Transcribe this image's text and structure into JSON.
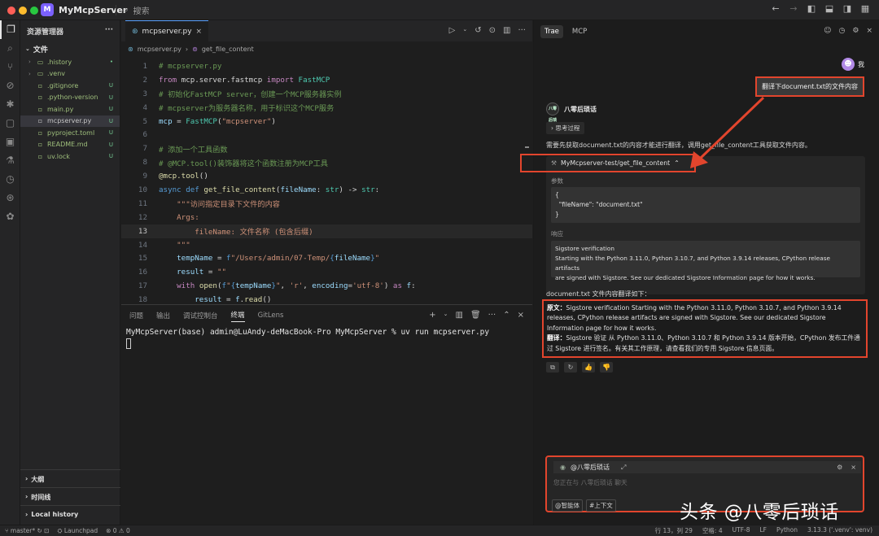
{
  "window": {
    "project_badge": "M",
    "project_name": "MyMcpServer",
    "search_placeholder": "搜索"
  },
  "explorer": {
    "title": "资源管理器",
    "section": "文件",
    "items": [
      {
        "name": ".history",
        "kind": "folder",
        "badge": "•"
      },
      {
        "name": ".venv",
        "kind": "folder",
        "badge": ""
      },
      {
        "name": ".gitignore",
        "kind": "file",
        "badge": "U"
      },
      {
        "name": ".python-version",
        "kind": "file",
        "badge": "U"
      },
      {
        "name": "main.py",
        "kind": "file",
        "badge": "U"
      },
      {
        "name": "mcpserver.py",
        "kind": "file",
        "badge": "U"
      },
      {
        "name": "pyproject.toml",
        "kind": "file",
        "badge": "U"
      },
      {
        "name": "README.md",
        "kind": "file",
        "badge": "U"
      },
      {
        "name": "uv.lock",
        "kind": "file",
        "badge": "U"
      }
    ],
    "bottom_sections": [
      "大纲",
      "时间线",
      "Local history"
    ]
  },
  "editor": {
    "tab_label": "mcpserver.py",
    "breadcrumb_file": "mcpserver.py",
    "breadcrumb_symbol": "get_file_content",
    "line_numbers": [
      "1",
      "2",
      "3",
      "4",
      "5",
      "6",
      "7",
      "8",
      "9",
      "10",
      "11",
      "12",
      "13",
      "14",
      "15",
      "16",
      "17",
      "18"
    ]
  },
  "panel": {
    "tabs": [
      "问题",
      "输出",
      "调试控制台",
      "终端",
      "GitLens"
    ],
    "active_tab": "终端",
    "terminal_line": "MyMcpServer(base) admin@LuAndy-deMacBook-Pro MyMcpServer % uv run mcpserver.py"
  },
  "chat": {
    "tabs": [
      "Trae",
      "MCP"
    ],
    "user_name": "我",
    "user_message": "翻译下document.txt的文件内容",
    "bot_name": "八零后琐话",
    "bot_avatar_text": "八零后琐话",
    "thinking_label": "思考过程",
    "intro": "需要先获取document.txt的内容才能进行翻译，调用get_file_content工具获取文件内容。",
    "tool_name": "MyMcpserver-test/get_file_content",
    "param_label": "参数",
    "params_lines": [
      "{",
      "  \"fileName\": \"document.txt\"",
      "}"
    ],
    "response_label": "响应",
    "response_lines": [
      "Sigstore verification",
      "Starting with the Python 3.11.0, Python 3.10.7, and Python 3.9.14 releases, CPython release artifacts",
      "are signed with Sigstore. See our dedicated Sigstore Information page for how it works."
    ],
    "translate_title": "document.txt 文件内容翻译如下：",
    "original_label": "原文：",
    "original_text": "Sigstore verification Starting with the Python 3.11.0, Python 3.10.7, and Python 3.9.14 releases, CPython release artifacts are signed with Sigstore. See our dedicated Sigstore Information page for how it works.",
    "translated_label": "翻译：",
    "translated_text": "Sigstore 验证 从 Python 3.11.0、Python 3.10.7 和 Python 3.9.14 版本开始，CPython 发布工件通过 Sigstore 进行签名。有关其工作原理，请查看我们的专用 Sigstore 信息页面。",
    "mention_chip": "@八零后琐话",
    "input_placeholder": "您正在与 八零后琐话 聊天",
    "btn_agent": "@智能体",
    "btn_context": "#上下文"
  },
  "watermark": "头条 @八零后琐话",
  "statusbar": {
    "branch": "master*",
    "launchpad": "Launchpad",
    "problems": "⊗ 0 ⚠ 0",
    "position": "行 13，列 29",
    "spaces": "空格: 4",
    "encoding": "UTF-8",
    "eol": "LF",
    "language": "Python",
    "interpreter": "3.13.3 ('.venv': venv)"
  },
  "colors": {
    "highlight_red": "#e2452d",
    "accent_purple": "#7b61ff",
    "comment_green": "#6a9955",
    "keyword": "#c586c0",
    "string": "#ce9178"
  }
}
